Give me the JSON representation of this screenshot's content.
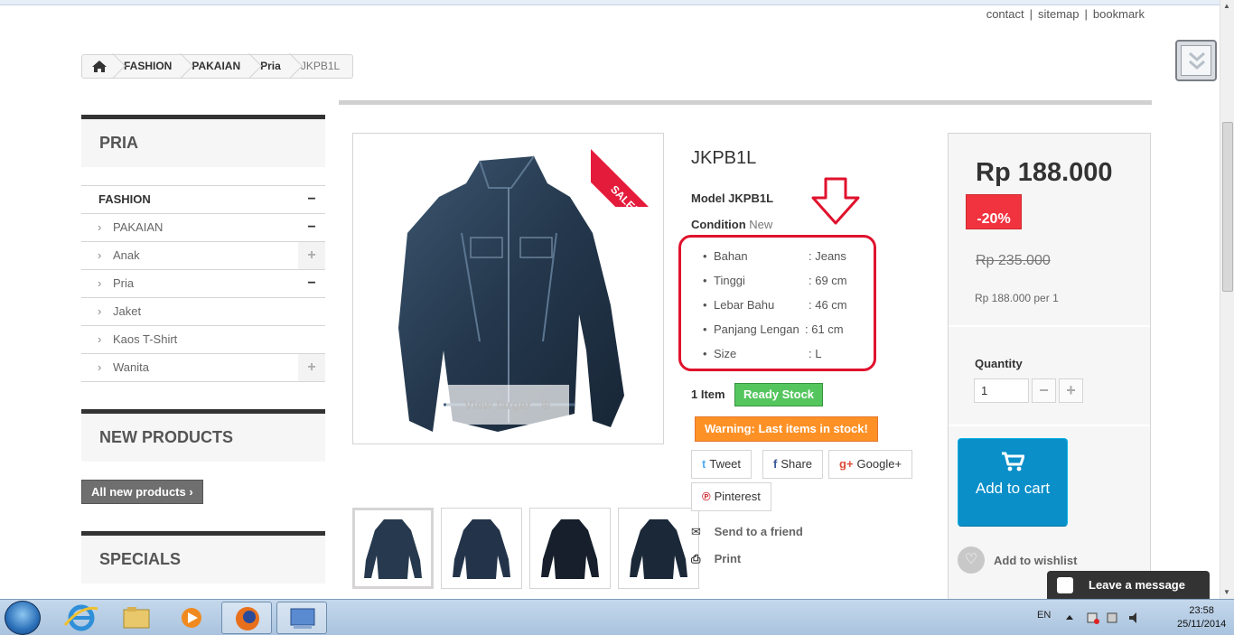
{
  "header": {
    "links": [
      "contact",
      "sitemap",
      "bookmark"
    ],
    "separator": "|"
  },
  "breadcrumb": {
    "items": [
      "FASHION",
      "PAKAIAN",
      "Pria",
      "JKPB1L"
    ]
  },
  "sidebar": {
    "block1_title": "PRIA",
    "categories": [
      {
        "label": "FASHION",
        "toggle": "−"
      },
      {
        "label": "PAKAIAN",
        "toggle": "−"
      },
      {
        "label": "Anak",
        "toggle": "+"
      },
      {
        "label": "Pria",
        "toggle": "−"
      },
      {
        "label": "Jaket",
        "toggle": ""
      },
      {
        "label": "Kaos T-Shirt",
        "toggle": ""
      },
      {
        "label": "Wanita",
        "toggle": "+"
      }
    ],
    "block2_title": "NEW PRODUCTS",
    "all_new_label": "All new products",
    "block3_title": "SPECIALS"
  },
  "product": {
    "sale_label": "SALE!",
    "view_larger": "View larger",
    "title": "JKPB1L",
    "model": "Model JKPB1L",
    "condition_label": "Condition",
    "condition_value": "New",
    "specs": [
      {
        "key": "Bahan",
        "value": ": Jeans"
      },
      {
        "key": "Tinggi",
        "value": ": 69 cm"
      },
      {
        "key": "Lebar Bahu",
        "value": ": 46 cm"
      },
      {
        "key": "Panjang Lengan",
        "value": ": 61 cm"
      },
      {
        "key": "Size",
        "value": ": L"
      }
    ],
    "items": "1 Item",
    "stock": "Ready Stock",
    "warning": "Warning: Last items in stock!",
    "share": {
      "tweet": "Tweet",
      "share": "Share",
      "google": "Google+",
      "pinterest": "Pinterest"
    },
    "send_friend": "Send to a friend",
    "print": "Print"
  },
  "buy": {
    "price": "Rp 188.000",
    "discount": "-20%",
    "old_price": "Rp 235.000",
    "per_unit": "Rp 188.000 per 1",
    "quantity_label": "Quantity",
    "quantity_value": "1",
    "minus": "−",
    "plus": "+",
    "add_to_cart": "Add to cart",
    "wishlist": "Add to wishlist"
  },
  "chat": {
    "label": "Leave a message"
  },
  "taskbar": {
    "lang": "EN",
    "time": "23:58",
    "date": "25/11/2014"
  },
  "colors": {
    "accent_blue": "#0a8fc9",
    "sale_red": "#e51b3c",
    "stock_green": "#55c65e",
    "warning_orange": "#fe9126",
    "annotation_red": "#e0122d"
  }
}
